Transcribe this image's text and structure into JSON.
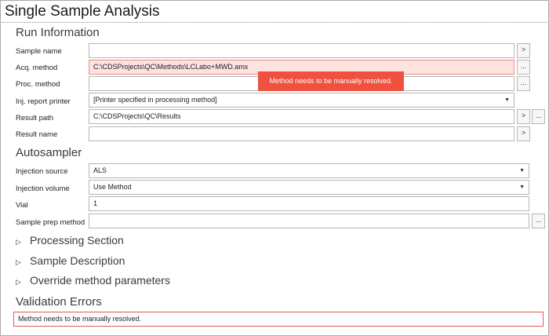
{
  "title": "Single Sample Analysis",
  "run_information": {
    "heading": "Run Information",
    "sample_name": {
      "label": "Sample name",
      "value": ""
    },
    "acq_method": {
      "label": "Acq. method",
      "value": "C:\\CDSProjects\\QC\\Methods\\LCLabo+MWD.amx"
    },
    "proc_method": {
      "label": "Proc. method",
      "value": ""
    },
    "inj_report_printer": {
      "label": "Inj. report printer",
      "value": "[Printer specified in processing method]"
    },
    "result_path": {
      "label": "Result path",
      "value": "C:\\CDSProjects\\QC\\Results"
    },
    "result_name": {
      "label": "Result name",
      "value": ""
    }
  },
  "tooltip": "Method needs to be manually resolved.",
  "autosampler": {
    "heading": "Autosampler",
    "injection_source": {
      "label": "Injection source",
      "value": "ALS"
    },
    "injection_volume": {
      "label": "Injection volume",
      "value": "Use Method"
    },
    "vial": {
      "label": "Vial",
      "value": "1"
    },
    "sample_prep_method": {
      "label": "Sample prep method",
      "value": ""
    }
  },
  "sections": {
    "processing": "Processing Section",
    "sample_description": "Sample Description",
    "override": "Override method parameters"
  },
  "validation": {
    "heading": "Validation Errors",
    "message": "Method needs to be manually resolved."
  },
  "buttons": {
    "next": ">",
    "browse": "..."
  },
  "icons": {
    "collapse": "triangle-right-icon",
    "dropdown": "caret-down-icon"
  },
  "colors": {
    "error_fill": "#fde2e0",
    "error_border": "#e05a4e",
    "tooltip_bg": "#f0513e"
  }
}
